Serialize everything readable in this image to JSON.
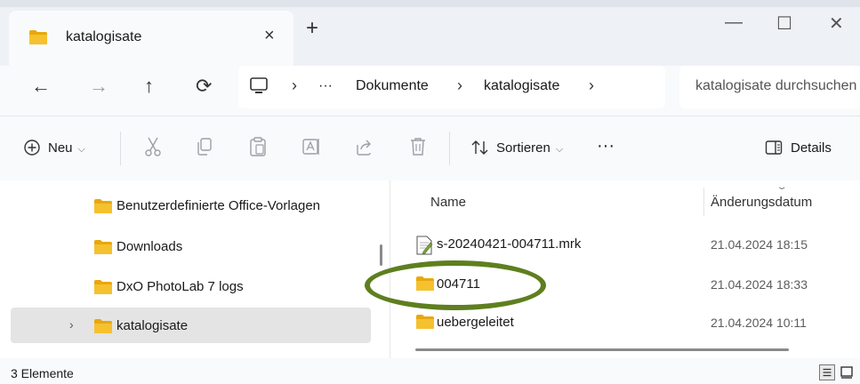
{
  "tab": {
    "title": "katalogisate",
    "close": "×",
    "new_tab": "+"
  },
  "window_controls": {
    "minimize": "—",
    "maximize": "☐",
    "close": "✕"
  },
  "nav": {
    "back": "←",
    "forward": "→",
    "up": "↑",
    "refresh": "⟳"
  },
  "address": {
    "overflow": "···",
    "sep": "›",
    "crumbs": [
      "Dokumente",
      "katalogisate"
    ]
  },
  "search": {
    "placeholder": "katalogisate durchsuchen"
  },
  "toolbar": {
    "new_label": "Neu",
    "sort_label": "Sortieren",
    "more": "···",
    "details_label": "Details",
    "chev": "⌵"
  },
  "navpane": {
    "items": [
      {
        "label": "Benutzerdefinierte Office-Vorlagen"
      },
      {
        "label": "Downloads"
      },
      {
        "label": "DxO PhotoLab 7 logs"
      },
      {
        "label": "katalogisate",
        "expander": "›"
      }
    ]
  },
  "filelist": {
    "columns": {
      "name": "Name",
      "date": "Änderungsdatum"
    },
    "sort_arrow": "⌄",
    "rows": [
      {
        "name": "s-20240421-004711.mrk",
        "date": "21.04.2024 18:15",
        "icon": "mrk-file-icon"
      },
      {
        "name": "004711",
        "date": "21.04.2024 18:33",
        "icon": "folder-icon"
      },
      {
        "name": "uebergeleitet",
        "date": "21.04.2024 10:11",
        "icon": "folder-icon"
      }
    ]
  },
  "status": {
    "count": "3 Elemente"
  },
  "colors": {
    "folder": "#f5c12e",
    "highlight": "#5e7f1f",
    "selected": "#e4e4e4"
  }
}
